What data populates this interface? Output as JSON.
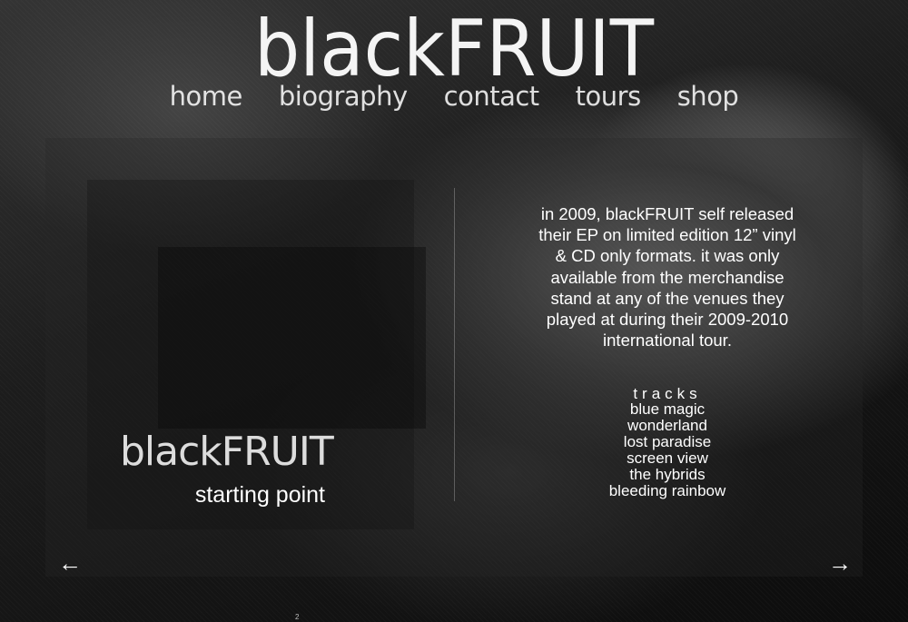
{
  "site": {
    "logo": "blackFRUIT"
  },
  "nav": {
    "items": [
      {
        "label": "home"
      },
      {
        "label": "biography"
      },
      {
        "label": "contact"
      },
      {
        "label": "tours"
      },
      {
        "label": "shop"
      }
    ]
  },
  "release": {
    "artist": "blackFRUIT",
    "title": "starting point",
    "description": "in 2009, blackFRUIT self released their EP on limited edition 12” vinyl & CD only formats. it was only available from the merchandise stand at any of the venues they played at during their 2009-2010 international tour.",
    "tracks_heading": "tracks",
    "tracks": [
      "blue magic",
      "wonderland",
      "lost paradise",
      "screen view",
      "the hybrids",
      "bleeding rainbow"
    ]
  },
  "pager": {
    "prev_icon": "←",
    "next_icon": "→",
    "marker": "2"
  },
  "colors": {
    "text": "#ffffff",
    "panel": "#282828"
  }
}
